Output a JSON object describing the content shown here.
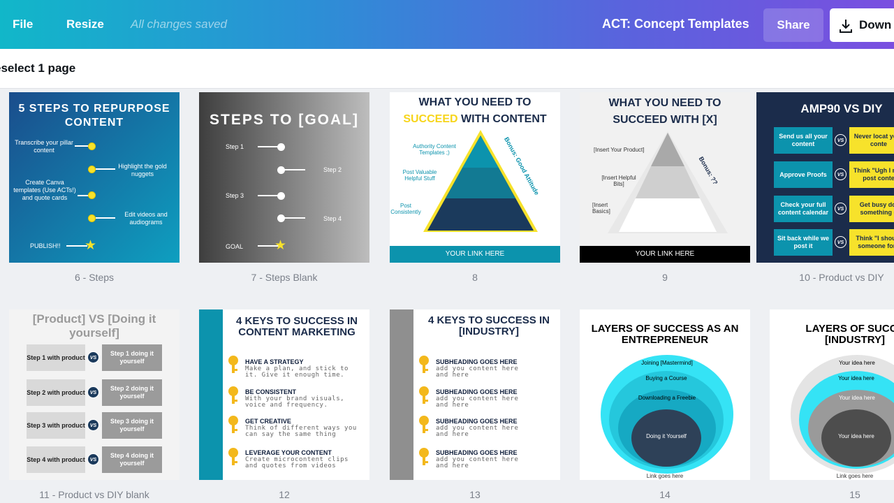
{
  "topbar": {
    "file": "File",
    "resize": "Resize",
    "saved": "All changes saved",
    "doc_title": "ACT: Concept Templates",
    "share": "Share",
    "download": "Down"
  },
  "subbar": {
    "deselect": "eselect 1 page"
  },
  "colors": {
    "accent_teal": "#0c93ad",
    "navy": "#1b2c4b",
    "yellow": "#f7e22b",
    "cyan": "#35e3f5"
  },
  "pages": [
    {
      "caption": "6 - Steps",
      "title": "5 STEPS TO REPURPOSE CONTENT",
      "steps": [
        "Transcribe your pillar content",
        "Highlight the gold nuggets",
        "Create Canva templates (Use ACTs!) and quote cards",
        "Edit videos and audiograms",
        "PUBLISH!!"
      ]
    },
    {
      "caption": "7 - Steps Blank",
      "title": "STEPS TO [GOAL]",
      "steps": [
        "Step 1",
        "Step 2",
        "Step 3",
        "Step 4",
        "GOAL"
      ]
    },
    {
      "caption": "8",
      "title_1": "WHAT YOU NEED TO",
      "title_2a": "SUCCEED",
      "title_2b": " WITH CONTENT",
      "labels": [
        "Authority Content Templates ;)",
        "Post Valuable Helpful Stuff",
        "Post Consistently"
      ],
      "bonus": "Bonus: Good Attitude",
      "link": "YOUR LINK HERE"
    },
    {
      "caption": "9",
      "title_1": "WHAT YOU NEED TO",
      "title_2": "SUCCEED WITH [X]",
      "labels": [
        "[Insert Your Product]",
        "[Insert Helpful Bits]",
        "[Insert Basics]"
      ],
      "bonus": "Bonus: ??",
      "link": "YOUR LINK HERE"
    },
    {
      "caption": "10 - Product vs DIY",
      "title": "AMP90 VS DIY",
      "left": [
        "Send us all your content",
        "Approve Proofs",
        "Check your full content calendar",
        "Sit back while we post it"
      ],
      "right": [
        "Never locat your conte",
        "Think \"Ugh I n to post conte",
        "Get busy doi something e",
        "Think \"I should someone for t"
      ],
      "vs": "VS"
    },
    {
      "caption": "11 - Product vs DIY blank",
      "title": "[Product] VS [Doing it yourself]",
      "left": [
        "Step 1 with product",
        "Step 2 with product",
        "Step 3 with product",
        "Step 4 with product"
      ],
      "right": [
        "Step 1 doing it yourself",
        "Step 2 doing it yourself",
        "Step 3 doing it yourself",
        "Step 4 doing it yourself"
      ],
      "vs": "VS"
    },
    {
      "caption": "12",
      "title": "4 KEYS TO SUCCESS IN CONTENT MARKETING",
      "keys": [
        {
          "h": "HAVE A STRATEGY",
          "t": "Make a plan, and stick to it. Give it enough time."
        },
        {
          "h": "BE CONSISTENT",
          "t": "With your brand visuals, voice and frequency."
        },
        {
          "h": "GET CREATIVE",
          "t": "Think of different ways you can say the same thing"
        },
        {
          "h": "LEVERAGE YOUR CONTENT",
          "t": "Create microcontent clips and quotes from videos"
        }
      ]
    },
    {
      "caption": "13",
      "title": "4 KEYS TO SUCCESS IN [INDUSTRY]",
      "keys": [
        {
          "h": "SUBHEADING GOES HERE",
          "t": "add you content here and here"
        },
        {
          "h": "SUBHEADING GOES HERE",
          "t": "add you content here and here"
        },
        {
          "h": "SUBHEADING GOES HERE",
          "t": "add you content here and here"
        },
        {
          "h": "SUBHEADING GOES HERE",
          "t": "add you content here and here"
        }
      ]
    },
    {
      "caption": "14",
      "title": "LAYERS OF SUCCESS AS AN ENTREPRENEUR",
      "layers": [
        "Joining [Mastermind]",
        "Buying a Course",
        "Downloading a Freebie",
        "Doing it Yourself"
      ],
      "link": "Link goes here"
    },
    {
      "caption": "15",
      "title": "LAYERS OF SUCCE [INDUSTRY]",
      "layers": [
        "Your idea here",
        "Your idea here",
        "Your idea here",
        "Your idea here"
      ],
      "link": "Link goes here"
    }
  ]
}
